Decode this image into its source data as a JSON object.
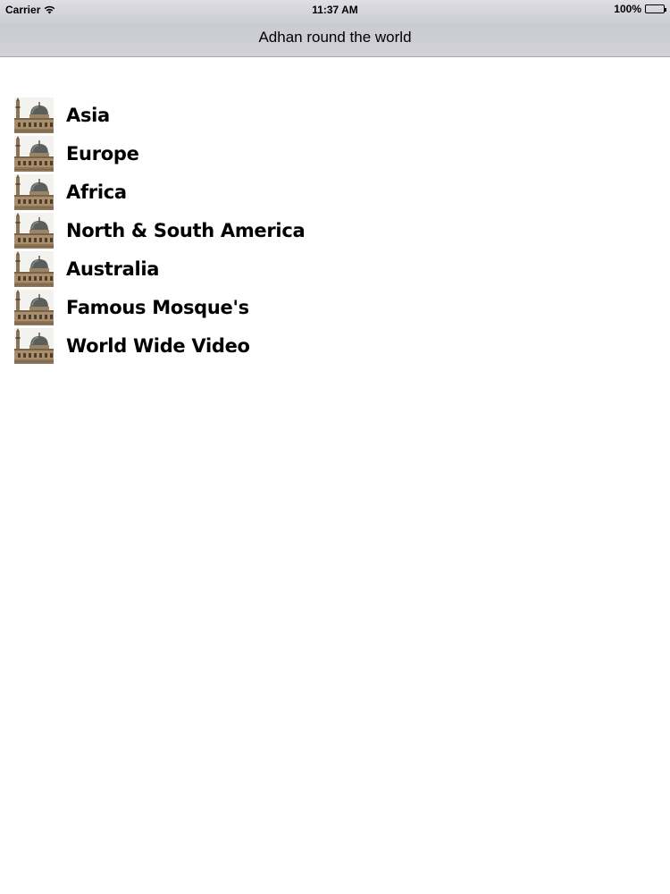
{
  "status_bar": {
    "carrier": "Carrier",
    "time": "11:37 AM",
    "battery": "100%",
    "wifi_icon": "wifi-icon",
    "battery_icon": "battery-icon"
  },
  "nav": {
    "title": "Adhan round the world"
  },
  "menu": {
    "icon": "mosque-icon",
    "items": [
      {
        "label": "Asia"
      },
      {
        "label": "Europe"
      },
      {
        "label": "Africa"
      },
      {
        "label": "North & South America"
      },
      {
        "label": "Australia"
      },
      {
        "label": "Famous Mosque's"
      },
      {
        "label": "World Wide Video"
      }
    ]
  }
}
